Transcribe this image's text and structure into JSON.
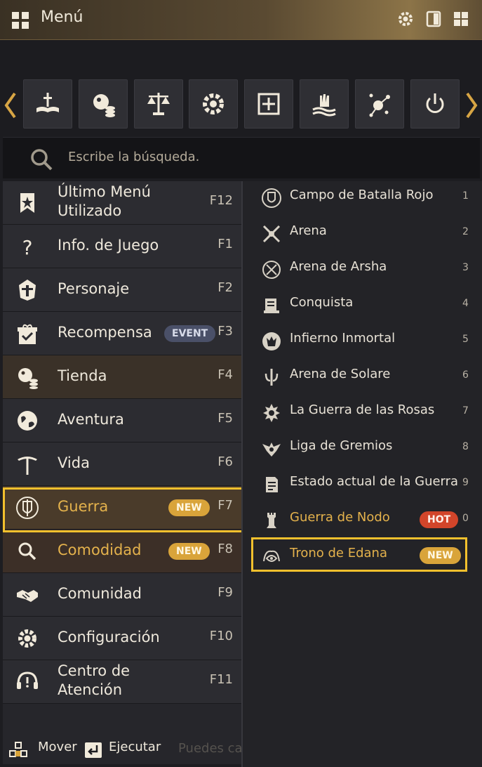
{
  "window": {
    "title": "Menú"
  },
  "title_icons": [
    "grid-icon",
    "settings-icon",
    "window-mode-icon",
    "grid-view-icon"
  ],
  "quick_buttons": [
    "book-sword-icon",
    "pearl-shop-icon",
    "market-scale-icon",
    "settings-icon",
    "plus-box-icon",
    "crystal-hand-icon",
    "network-icon",
    "power-icon"
  ],
  "search": {
    "placeholder": "Escribe la búsqueda."
  },
  "left_menu": [
    {
      "line1": "Último Menú",
      "line2": "Utilizado",
      "key": "F12",
      "icon": "bookmark-star-icon"
    },
    {
      "label": "Info. de Juego",
      "key": "F1",
      "icon": "question-icon"
    },
    {
      "label": "Personaje",
      "key": "F2",
      "icon": "helmet-icon"
    },
    {
      "label": "Recompensa",
      "key": "F3",
      "badge": "EVENT",
      "icon": "gift-icon"
    },
    {
      "label": "Tienda",
      "key": "F4",
      "icon": "pearl-shop-icon"
    },
    {
      "label": "Aventura",
      "key": "F5",
      "icon": "globe-icon"
    },
    {
      "label": "Vida",
      "key": "F6",
      "icon": "pickaxe-icon"
    },
    {
      "label": "Guerra",
      "key": "F7",
      "badge": "NEW",
      "icon": "war-shield-icon"
    },
    {
      "label": "Comodidad",
      "key": "F8",
      "badge": "NEW",
      "icon": "search-icon"
    },
    {
      "label": "Comunidad",
      "key": "F9",
      "icon": "handshake-icon"
    },
    {
      "label": "Configuración",
      "key": "F10",
      "icon": "gear-icon"
    },
    {
      "line1": "Centro de",
      "line2": "Atención",
      "key": "F11",
      "icon": "support-headset-icon"
    }
  ],
  "war_submenu": [
    {
      "label": "Campo de Batalla Rojo",
      "num": "1",
      "icon": "red-battlefield-icon"
    },
    {
      "label": "Arena",
      "num": "2",
      "icon": "crossed-swords-icon"
    },
    {
      "label": "Arena de Arsha",
      "num": "3",
      "icon": "arsha-emblem-icon"
    },
    {
      "label": "Conquista",
      "num": "4",
      "icon": "scroll-icon"
    },
    {
      "label": "Infierno Inmortal",
      "num": "5",
      "icon": "demon-emblem-icon"
    },
    {
      "label": "Arena de Solare",
      "num": "6",
      "icon": "solare-emblem-icon"
    },
    {
      "label": "La Guerra de las Rosas",
      "num": "7",
      "icon": "rose-emblem-icon"
    },
    {
      "label": "Liga de Gremios",
      "num": "8",
      "icon": "winged-emblem-icon"
    },
    {
      "label": "Estado actual de la Guerra",
      "num": "9",
      "icon": "document-icon"
    },
    {
      "label": "Guerra de Nodo",
      "num": "0",
      "badge": "HOT",
      "icon": "tower-icon"
    },
    {
      "label": "Trono de Edana",
      "badge": "NEW",
      "icon": "edana-emblem-icon"
    }
  ],
  "footer": {
    "move": "Mover",
    "execute": "Ejecutar"
  },
  "background_text": "Puedes ca",
  "colors": {
    "accent": "#e4b24c",
    "highlight": "#f2c02d",
    "panel": "#2c2c31",
    "hot": "#d2452a",
    "event": "#4a5068"
  }
}
